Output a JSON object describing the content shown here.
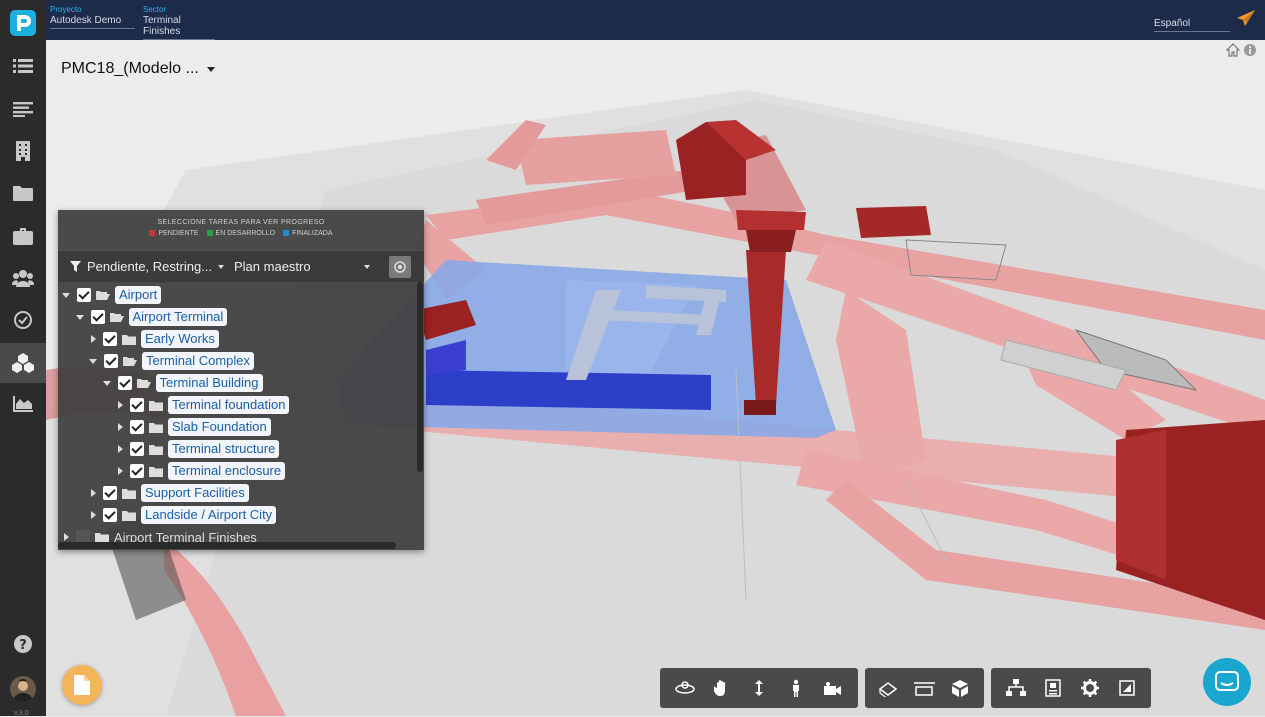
{
  "header": {
    "project_label": "Proyecto",
    "project_value": "Autodesk Demo",
    "sector_label": "Sector",
    "sector_value": "Terminal Finishes",
    "language": "Español"
  },
  "sidebar": {
    "items": [
      {
        "icon": "list-icon"
      },
      {
        "icon": "text-lines-icon"
      },
      {
        "icon": "building-icon"
      },
      {
        "icon": "folder-icon"
      },
      {
        "icon": "briefcase-icon"
      },
      {
        "icon": "users-icon"
      },
      {
        "icon": "check-circle-icon"
      },
      {
        "icon": "cubes-icon",
        "active": true
      },
      {
        "icon": "area-chart-icon"
      }
    ],
    "help_icon": "help-icon",
    "version": "v.3.0"
  },
  "viewer": {
    "model_title": "PMC18_(Modelo ...",
    "home_icon": "home-icon",
    "info_icon": "info-icon"
  },
  "progress_panel": {
    "title": "SELECCIONE TAREAS PARA VER PROGRESO",
    "legend": [
      {
        "label": "PENDIENTE",
        "color": "#c0393b"
      },
      {
        "label": "EN DESARROLLO",
        "color": "#27a04a"
      },
      {
        "label": "FINALIZADA",
        "color": "#1d8fd0"
      }
    ],
    "filter_status": "Pendiente, Restring...",
    "filter_plan": "Plan maestro",
    "tree": [
      {
        "label": "Airport",
        "level": 0,
        "expanded": true,
        "checked": true,
        "open_folder": true,
        "highlight": true
      },
      {
        "label": "Airport Terminal",
        "level": 1,
        "expanded": true,
        "checked": true,
        "open_folder": true,
        "highlight": true
      },
      {
        "label": "Early Works",
        "level": 2,
        "expanded": false,
        "checked": true,
        "open_folder": false,
        "highlight": true
      },
      {
        "label": "Terminal Complex",
        "level": 2,
        "expanded": true,
        "checked": true,
        "open_folder": true,
        "highlight": true
      },
      {
        "label": "Terminal Building",
        "level": 3,
        "expanded": true,
        "checked": true,
        "open_folder": true,
        "highlight": true
      },
      {
        "label": "Terminal foundation",
        "level": 4,
        "expanded": false,
        "checked": true,
        "open_folder": false,
        "highlight": true
      },
      {
        "label": "Slab Foundation",
        "level": 4,
        "expanded": false,
        "checked": true,
        "open_folder": false,
        "highlight": true
      },
      {
        "label": "Terminal structure",
        "level": 4,
        "expanded": false,
        "checked": true,
        "open_folder": false,
        "highlight": true
      },
      {
        "label": "Terminal enclosure",
        "level": 4,
        "expanded": false,
        "checked": true,
        "open_folder": false,
        "highlight": true
      },
      {
        "label": "Support Facilities",
        "level": 2,
        "expanded": false,
        "checked": true,
        "open_folder": false,
        "highlight": true
      },
      {
        "label": "Landside / Airport City",
        "level": 2,
        "expanded": false,
        "checked": true,
        "open_folder": false,
        "highlight": true
      },
      {
        "label": "Airport Terminal Finishes",
        "level": 0,
        "expanded": false,
        "checked": false,
        "open_folder": false,
        "highlight": false
      }
    ]
  },
  "toolbar": {
    "groups": [
      [
        "orbit-icon",
        "pan-hand-icon",
        "zoom-arrows-icon",
        "first-person-icon",
        "camera-icon"
      ],
      [
        "measure-icon",
        "section-icon",
        "explode-cube-icon"
      ],
      [
        "model-tree-icon",
        "properties-icon",
        "settings-gear-icon",
        "fullscreen-icon"
      ]
    ]
  }
}
